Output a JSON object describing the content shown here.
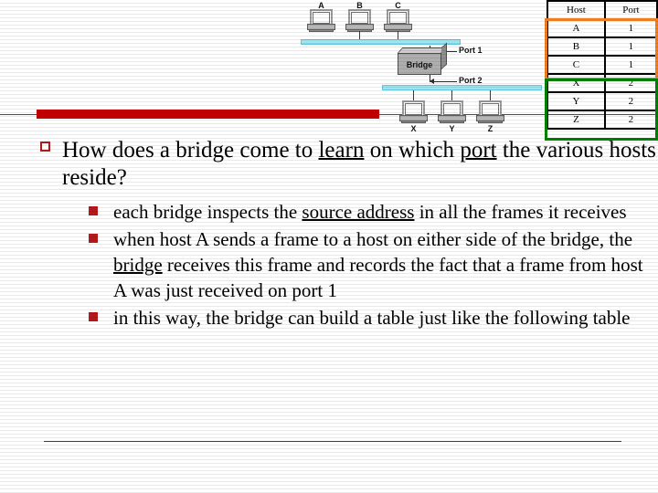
{
  "slide": {
    "title_question": {
      "pre": "How does a bridge come to ",
      "u1": "learn",
      "mid": " on which ",
      "u2": "port",
      "post": " the various hosts reside?"
    },
    "bullets": [
      {
        "pre": "each bridge inspects the ",
        "u1": "source address",
        "post": " in all the frames it receives"
      },
      {
        "pre": "when host A sends a frame to a host on either side of the bridge, the ",
        "u1": "bridge",
        "post": " receives this frame and records the fact that a frame from host A was just received on port 1"
      },
      {
        "pre": "in this way, the bridge can build a table just like the following table",
        "u1": "",
        "post": ""
      }
    ]
  },
  "bridge_table": {
    "headers": [
      "Host",
      "Port"
    ],
    "rows": [
      {
        "host": "A",
        "port": "1"
      },
      {
        "host": "B",
        "port": "1"
      },
      {
        "host": "C",
        "port": "1"
      },
      {
        "host": "X",
        "port": "2"
      },
      {
        "host": "Y",
        "port": "2"
      },
      {
        "host": "Z",
        "port": "2"
      }
    ],
    "highlight_port1_color": "#ED7D1F",
    "highlight_port2_color": "#008000"
  },
  "diagram": {
    "top_hosts": [
      "A",
      "B",
      "C"
    ],
    "bottom_hosts": [
      "X",
      "Y",
      "Z"
    ],
    "bridge_label": "Bridge",
    "port1_label": "Port 1",
    "port2_label": "Port 2",
    "cable_color": "#9ee3f0"
  },
  "decor": {
    "accent_bar_color": "#C00000",
    "rule_color": "#7b2c2c"
  }
}
